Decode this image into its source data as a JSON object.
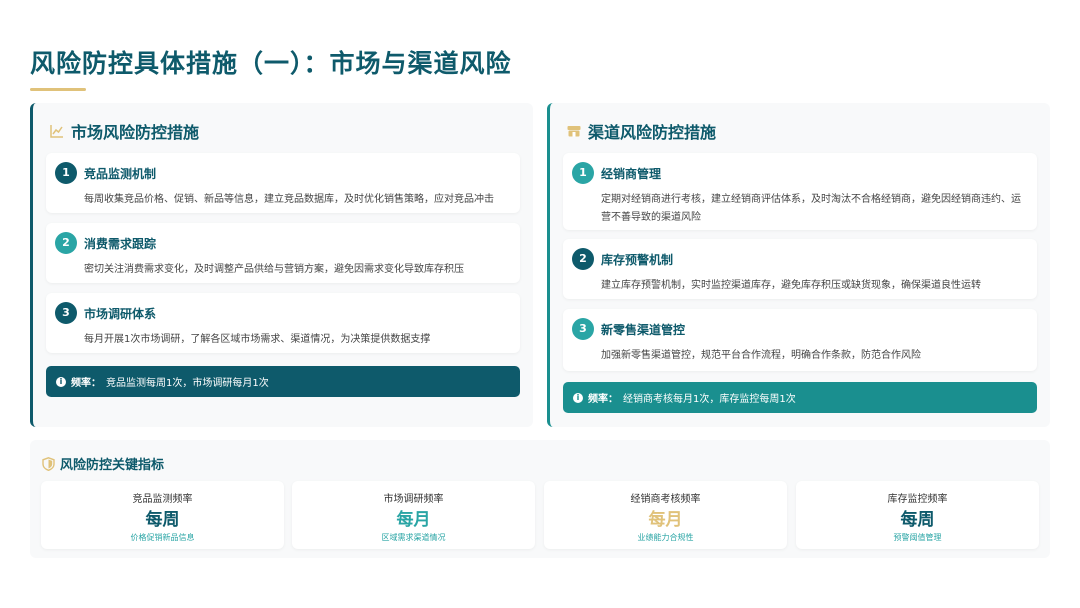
{
  "page": {
    "title": "风险防控具体措施（一）：市场与渠道风险"
  },
  "market": {
    "heading": "市场风险防控措施",
    "icon": "line-chart-icon",
    "items": [
      {
        "num": "1",
        "title": "竞品监测机制",
        "desc": "每周收集竞品价格、促销、新品等信息，建立竞品数据库，及时优化销售策略，应对竞品冲击"
      },
      {
        "num": "2",
        "title": "消费需求跟踪",
        "desc": "密切关注消费需求变化，及时调整产品供给与营销方案，避免因需求变化导致库存积压"
      },
      {
        "num": "3",
        "title": "市场调研体系",
        "desc": "每月开展1次市场调研，了解各区域市场需求、渠道情况，为决策提供数据支撑"
      }
    ],
    "freq_label": "频率：",
    "freq_text": "竞品监测每周1次，市场调研每月1次"
  },
  "channel": {
    "heading": "渠道风险防控措施",
    "icon": "store-icon",
    "items": [
      {
        "num": "1",
        "title": "经销商管理",
        "desc": "定期对经销商进行考核，建立经销商评估体系，及时淘汰不合格经销商，避免因经销商违约、运营不善导致的渠道风险"
      },
      {
        "num": "2",
        "title": "库存预警机制",
        "desc": "建立库存预警机制，实时监控渠道库存，避免库存积压或缺货现象，确保渠道良性运转"
      },
      {
        "num": "3",
        "title": "新零售渠道管控",
        "desc": "加强新零售渠道管控，规范平台合作流程，明确合作条款，防范合作风险"
      }
    ],
    "freq_label": "频率：",
    "freq_text": "经销商考核每月1次，库存监控每周1次"
  },
  "kpis": {
    "heading": "风险防控关键指标",
    "icon": "shield-icon",
    "items": [
      {
        "label": "竞品监测频率",
        "value": "每周",
        "sub": "价格促销新品信息",
        "color": "#0e5a6b"
      },
      {
        "label": "市场调研频率",
        "value": "每月",
        "sub": "区域需求渠道情况",
        "color": "#2aa5a5"
      },
      {
        "label": "经销商考核频率",
        "value": "每月",
        "sub": "业绩能力合规性",
        "color": "#e0c27a"
      },
      {
        "label": "库存监控频率",
        "value": "每周",
        "sub": "预警阈值管理",
        "color": "#0e5a6b"
      }
    ]
  },
  "colors": {
    "primary": "#0e5a6b",
    "teal": "#1a8f8f",
    "gold": "#e0c27a"
  }
}
